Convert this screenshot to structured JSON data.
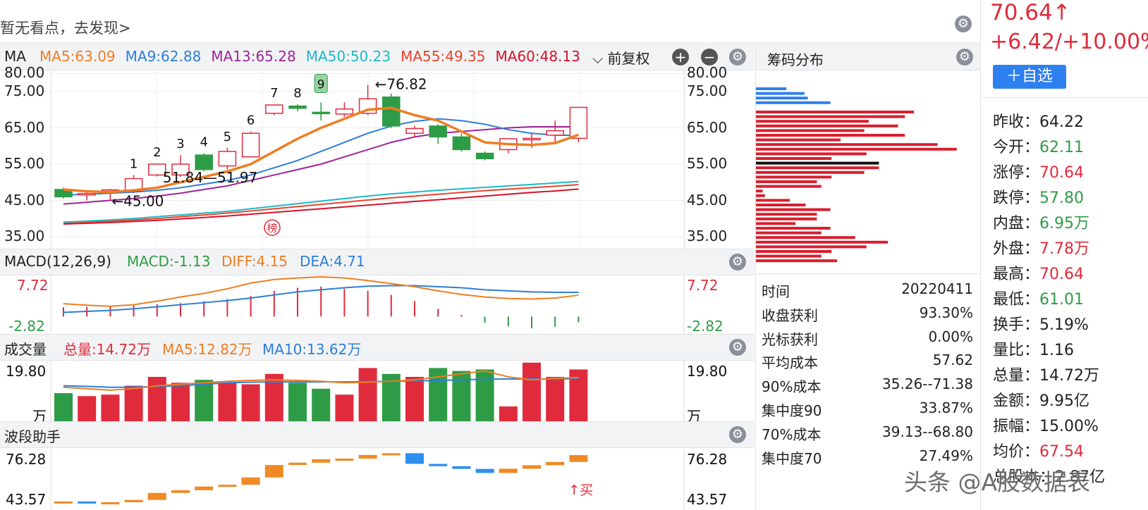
{
  "colors": {
    "up": "#e02b3c",
    "down": "#2e9c46",
    "ma5": "#ef7d22",
    "ma9": "#2b7fd9",
    "ma13": "#a1239a",
    "ma50": "#1fb9c7",
    "ma55": "#e8452b",
    "ma60": "#d6122a",
    "accent": "#2e7ff0"
  },
  "top": {
    "note": "暂无看点，去发现>"
  },
  "kline": {
    "title": "MA",
    "legend": [
      {
        "key": "ma5",
        "text": "MA5:63.09"
      },
      {
        "key": "ma9",
        "text": "MA9:62.88"
      },
      {
        "key": "ma13",
        "text": "MA13:65.28"
      },
      {
        "key": "ma50",
        "text": "MA50:50.23"
      },
      {
        "key": "ma55",
        "text": "MA55:49.35"
      },
      {
        "key": "ma60",
        "text": "MA60:48.13"
      }
    ],
    "fq": "前复权",
    "axis": [
      "80.00",
      "75.00",
      "65.00",
      "55.00",
      "45.00",
      "35.00"
    ],
    "annotations": {
      "high": "←76.82",
      "low": "←45.00",
      "range": "51.84—51.97",
      "bang": "榜"
    },
    "counts": [
      "1",
      "2",
      "3",
      "4",
      "5",
      "6",
      "7",
      "8",
      "9"
    ]
  },
  "macd": {
    "title": "MACD(12,26,9)",
    "macd": "MACD:-1.13",
    "diff": "DIFF:4.15",
    "dea": "DEA:4.71",
    "top": "7.72",
    "bottom": "-2.82"
  },
  "vol": {
    "title": "成交量",
    "total": "总量:14.72万",
    "ma5": "MA5:12.82万",
    "ma10": "MA10:13.62万",
    "top": "19.80",
    "unit": "万"
  },
  "wave": {
    "title": "波段助手",
    "top": "76.28",
    "bottom": "43.57",
    "buy": "↑买"
  },
  "chip": {
    "title": "筹码分布",
    "rows": [
      {
        "k": "时间",
        "v": "20220411"
      },
      {
        "k": "收盘获利",
        "v": "93.30%"
      },
      {
        "k": "光标获利",
        "v": "0.00%"
      },
      {
        "k": "平均成本",
        "v": "57.62"
      },
      {
        "k": "90%成本",
        "v": "35.26--71.38"
      },
      {
        "k": "集中度90",
        "v": "33.87%"
      },
      {
        "k": "70%成本",
        "v": "39.13--68.80"
      },
      {
        "k": "集中度70",
        "v": "27.49%"
      }
    ]
  },
  "quote": {
    "price": "70.64↑",
    "change": "+6.42/+10.00%",
    "watch": "＋自选",
    "stats": [
      {
        "k": "昨收：",
        "v": "64.22",
        "c": "#222"
      },
      {
        "k": "今开：",
        "v": "62.11",
        "c": "#2e9c46"
      },
      {
        "k": "涨停：",
        "v": "70.64",
        "c": "#e02b3c"
      },
      {
        "k": "跌停：",
        "v": "57.80",
        "c": "#2e9c46"
      },
      {
        "k": "内盘：",
        "v": "6.95万",
        "c": "#2e9c46"
      },
      {
        "k": "外盘：",
        "v": "7.78万",
        "c": "#e02b3c"
      },
      {
        "k": "最高：",
        "v": "70.64",
        "c": "#e02b3c"
      },
      {
        "k": "最低：",
        "v": "61.01",
        "c": "#2e9c46"
      },
      {
        "k": "换手：",
        "v": "5.19%",
        "c": "#222"
      },
      {
        "k": "量比：",
        "v": "1.16",
        "c": "#222"
      },
      {
        "k": "总量：",
        "v": "14.72万",
        "c": "#222"
      },
      {
        "k": "金额：",
        "v": "9.95亿",
        "c": "#222"
      },
      {
        "k": "振幅：",
        "v": "15.00%",
        "c": "#222"
      },
      {
        "k": "均价：",
        "v": "67.54",
        "c": "#e02b3c"
      },
      {
        "k": "总股本：",
        "v": "2.87亿",
        "c": "#222"
      }
    ]
  },
  "watermark": "头条 @A股数据表",
  "chart_data": {
    "type": "candlestick",
    "candles": [
      {
        "o": 48.0,
        "c": 46.0,
        "h": 48.5,
        "l": 45.5
      },
      {
        "o": 46.8,
        "c": 46.9,
        "h": 47.5,
        "l": 45.0
      },
      {
        "o": 47.6,
        "c": 47.9,
        "h": 48.2,
        "l": 45.0
      },
      {
        "o": 47.5,
        "c": 51.0,
        "h": 52.0,
        "l": 47.0
      },
      {
        "o": 52.0,
        "c": 55.0,
        "h": 55.2,
        "l": 51.6
      },
      {
        "o": 52.0,
        "c": 55.0,
        "h": 57.5,
        "l": 51.5
      },
      {
        "o": 57.5,
        "c": 53.5,
        "h": 58.0,
        "l": 53.0
      },
      {
        "o": 54.5,
        "c": 58.5,
        "h": 59.5,
        "l": 53.5
      },
      {
        "o": 57.0,
        "c": 63.5,
        "h": 64.0,
        "l": 57.0
      },
      {
        "o": 69.0,
        "c": 71.3,
        "h": 71.5,
        "l": 68.5
      },
      {
        "o": 71.0,
        "c": 70.4,
        "h": 71.5,
        "l": 69.5
      },
      {
        "o": 69.3,
        "c": 69.2,
        "h": 72.0,
        "l": 67.0
      },
      {
        "o": 68.8,
        "c": 70.2,
        "h": 72.0,
        "l": 68.0
      },
      {
        "o": 69.0,
        "c": 73.0,
        "h": 76.82,
        "l": 68.5
      },
      {
        "o": 73.5,
        "c": 65.5,
        "h": 74.5,
        "l": 65.0
      },
      {
        "o": 63.5,
        "c": 64.8,
        "h": 65.5,
        "l": 62.5
      },
      {
        "o": 65.5,
        "c": 62.5,
        "h": 66.0,
        "l": 60.5
      },
      {
        "o": 62.5,
        "c": 59.0,
        "h": 63.5,
        "l": 58.5
      },
      {
        "o": 58.0,
        "c": 56.5,
        "h": 58.5,
        "l": 56.0
      },
      {
        "o": 59.0,
        "c": 62.0,
        "h": 62.0,
        "l": 58.0
      },
      {
        "o": 62.0,
        "c": 62.1,
        "h": 63.5,
        "l": 59.5
      },
      {
        "o": 63.0,
        "c": 64.2,
        "h": 67.0,
        "l": 61.0
      },
      {
        "o": 62.11,
        "c": 70.64,
        "h": 70.64,
        "l": 61.01
      }
    ],
    "ma5": [
      48.0,
      47.5,
      47.3,
      47.8,
      48.5,
      50.0,
      51.5,
      53.0,
      55.0,
      58.5,
      62.0,
      65.0,
      67.5,
      70.0,
      70.5,
      68.5,
      67.0,
      64.0,
      61.0,
      60.5,
      60.3,
      60.8,
      63.09
    ],
    "ma9": [
      46.5,
      46.7,
      47.0,
      47.3,
      47.8,
      48.5,
      49.5,
      50.5,
      52.0,
      54.0,
      56.0,
      58.5,
      61.0,
      63.5,
      65.5,
      66.8,
      67.5,
      67.0,
      66.0,
      64.5,
      63.5,
      63.0,
      62.88
    ],
    "ma13": [
      44.0,
      44.5,
      45.0,
      45.5,
      46.2,
      47.0,
      48.0,
      49.0,
      50.5,
      52.0,
      53.5,
      55.0,
      57.0,
      59.0,
      61.0,
      62.5,
      63.5,
      64.0,
      64.5,
      65.0,
      65.3,
      65.3,
      65.28
    ],
    "ma50": [
      39.0,
      39.3,
      39.6,
      40.0,
      40.5,
      41.0,
      41.5,
      42.0,
      42.7,
      43.4,
      44.1,
      44.8,
      45.5,
      46.2,
      46.8,
      47.3,
      47.8,
      48.2,
      48.6,
      49.0,
      49.4,
      49.8,
      50.23
    ],
    "ma55": [
      38.8,
      39.0,
      39.3,
      39.6,
      40.0,
      40.5,
      41.0,
      41.5,
      42.1,
      42.7,
      43.3,
      43.9,
      44.5,
      45.1,
      45.7,
      46.2,
      46.7,
      47.2,
      47.7,
      48.1,
      48.5,
      48.9,
      49.35
    ],
    "ma60": [
      38.5,
      38.7,
      38.9,
      39.2,
      39.5,
      39.9,
      40.3,
      40.7,
      41.2,
      41.7,
      42.2,
      42.7,
      43.2,
      43.7,
      44.2,
      44.7,
      45.2,
      45.7,
      46.2,
      46.7,
      47.2,
      47.6,
      48.13
    ],
    "volume": [
      9.5,
      8.5,
      9.0,
      12.0,
      15.0,
      13.0,
      14.0,
      13.0,
      12.5,
      16.0,
      13.0,
      11.0,
      9.0,
      18.0,
      16.0,
      15.0,
      18.0,
      17.0,
      17.5,
      5.0,
      19.8,
      15.0,
      17.5
    ],
    "vol_ma5": [
      11.5,
      11.0,
      10.5,
      11.0,
      12.0,
      12.5,
      13.0,
      13.5,
      13.8,
      14.0,
      13.8,
      13.5,
      13.0,
      13.2,
      13.5,
      14.0,
      15.0,
      16.0,
      17.0,
      15.0,
      14.0,
      14.5,
      14.8
    ],
    "vol_ma10": [
      12.0,
      11.8,
      11.5,
      11.5,
      11.8,
      12.0,
      12.5,
      13.0,
      13.2,
      13.3,
      13.3,
      13.3,
      13.3,
      13.4,
      13.5,
      13.6,
      13.8,
      14.0,
      14.2,
      14.3,
      14.3,
      14.2,
      14.5
    ],
    "macd_hist": [
      1.8,
      1.9,
      2.0,
      2.2,
      2.4,
      2.6,
      3.0,
      3.4,
      4.0,
      5.0,
      5.6,
      5.8,
      5.4,
      5.0,
      4.2,
      3.0,
      1.5,
      0.3,
      -1.2,
      -1.9,
      -2.3,
      -2.0,
      -1.13
    ],
    "diff": [
      2.5,
      2.2,
      2.0,
      2.3,
      3.0,
      3.8,
      4.5,
      5.4,
      6.5,
      7.2,
      7.5,
      7.72,
      7.5,
      7.0,
      6.4,
      5.8,
      5.0,
      4.3,
      3.8,
      3.5,
      3.4,
      3.6,
      4.15
    ],
    "dea": [
      0.8,
      1.0,
      1.2,
      1.5,
      1.9,
      2.3,
      2.7,
      3.1,
      3.6,
      4.2,
      4.8,
      5.2,
      5.6,
      5.9,
      6.0,
      6.0,
      5.8,
      5.6,
      5.2,
      5.0,
      4.8,
      4.7,
      4.71
    ],
    "wave": [
      44.6,
      43.9,
      44.2,
      45.4,
      49.0,
      50.4,
      52.3,
      53.2,
      57.0,
      63.4,
      64.6,
      66.4,
      66.7,
      68.6,
      69.5,
      64.0,
      62.8,
      61.4,
      59.3,
      61.5,
      63.3,
      65.0,
      68.5
    ],
    "chip_bars": [
      {
        "len": 27,
        "c": "b"
      },
      {
        "len": 43,
        "c": "b"
      },
      {
        "len": 46,
        "c": "b"
      },
      {
        "len": 66,
        "c": "b"
      },
      {
        "len": 0,
        "c": "r"
      },
      {
        "len": 140,
        "c": "r"
      },
      {
        "len": 132,
        "c": "r"
      },
      {
        "len": 100,
        "c": "r"
      },
      {
        "len": 126,
        "c": "r"
      },
      {
        "len": 96,
        "c": "r"
      },
      {
        "len": 132,
        "c": "r"
      },
      {
        "len": 75,
        "c": "r"
      },
      {
        "len": 161,
        "c": "r"
      },
      {
        "len": 178,
        "c": "r"
      },
      {
        "len": 98,
        "c": "r"
      },
      {
        "len": 67,
        "c": "r"
      },
      {
        "len": 109,
        "c": "k"
      },
      {
        "len": 109,
        "c": "r"
      },
      {
        "len": 96,
        "c": "r"
      },
      {
        "len": 67,
        "c": "r"
      },
      {
        "len": 54,
        "c": "r"
      },
      {
        "len": 58,
        "c": "r"
      },
      {
        "len": 6,
        "c": "r"
      },
      {
        "len": 8,
        "c": "r"
      },
      {
        "len": 30,
        "c": "r"
      },
      {
        "len": 44,
        "c": "r"
      },
      {
        "len": 66,
        "c": "r"
      },
      {
        "len": 54,
        "c": "r"
      },
      {
        "len": 54,
        "c": "r"
      },
      {
        "len": 35,
        "c": "r"
      },
      {
        "len": 66,
        "c": "r"
      },
      {
        "len": 58,
        "c": "r"
      },
      {
        "len": 88,
        "c": "r"
      },
      {
        "len": 117,
        "c": "r"
      },
      {
        "len": 98,
        "c": "r"
      },
      {
        "len": 67,
        "c": "r"
      },
      {
        "len": 58,
        "c": "r"
      },
      {
        "len": 72,
        "c": "r"
      }
    ]
  }
}
